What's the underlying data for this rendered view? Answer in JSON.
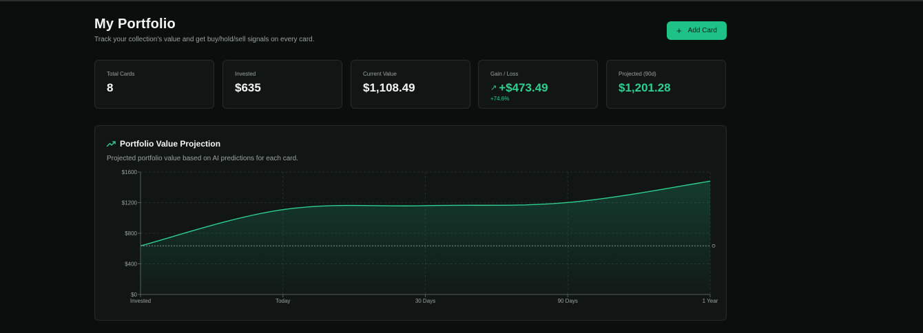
{
  "header": {
    "title": "My Portfolio",
    "subtitle": "Track your collection's value and get buy/hold/sell signals on every card.",
    "add_button": {
      "icon": "plus-icon",
      "label": "Add Card"
    }
  },
  "stats": [
    {
      "label": "Total Cards",
      "value": "8"
    },
    {
      "label": "Invested",
      "value": "$635"
    },
    {
      "label": "Current Value",
      "value": "$1,108.49"
    },
    {
      "label": "Gain / Loss",
      "value": "+$473.49",
      "sub": "+74.6%",
      "icon": "arrow-up-right-icon"
    },
    {
      "label": "Projected (90d)",
      "value": "$1,201.28"
    }
  ],
  "chart": {
    "title": "Portfolio Value Projection",
    "title_icon": "trending-up-icon",
    "description": "Projected portfolio value based on AI predictions for each card."
  },
  "colors": {
    "accent": "#1ec287",
    "positive": "#2fcf8f",
    "background": "#0a0e0d",
    "card": "#111615"
  },
  "chart_data": {
    "type": "area",
    "categories": [
      "Invested",
      "Today",
      "30 Days",
      "90 Days",
      "1 Year"
    ],
    "values": [
      635,
      1108.49,
      1160,
      1201.28,
      1480
    ],
    "ylim": [
      0,
      1600
    ],
    "y_ticks": [
      "$0",
      "$400",
      "$800",
      "$1200",
      "$1600"
    ],
    "y_tick_values": [
      0,
      400,
      800,
      1200,
      1600
    ],
    "reference_line": 635,
    "grid": true
  }
}
